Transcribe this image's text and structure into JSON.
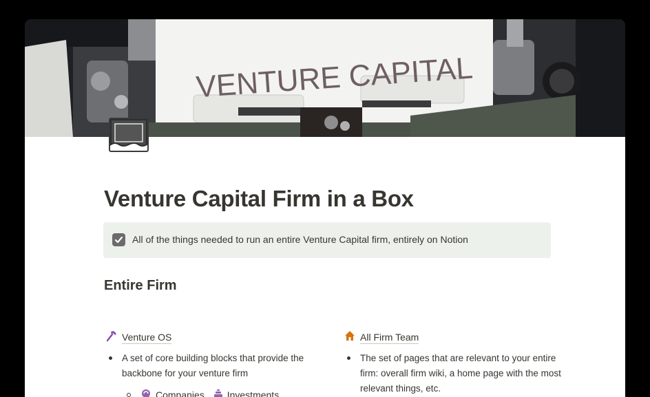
{
  "cover": {
    "banner_text": "VENTURE CAPITAL"
  },
  "page": {
    "title": "Venture Capital Firm in a Box",
    "callout_text": "All of the things needed to run an entire Venture Capital firm, entirely on Notion",
    "section_heading": "Entire Firm"
  },
  "columns": {
    "left": {
      "link_icon": "hammer-icon",
      "link_label": "Venture OS",
      "bullet": "A set of core building blocks that provide the backbone for your venture firm",
      "sub_items": [
        {
          "icon": "companies-icon",
          "label": "Companies"
        },
        {
          "icon": "investments-icon",
          "label": "Investments"
        }
      ],
      "sub_sep": ","
    },
    "right": {
      "link_icon": "house-icon",
      "link_label": "All Firm Team",
      "bullet": "The set of pages that are relevant to your entire firm: overall firm wiki, a home page with the most relevant things, etc."
    }
  },
  "colors": {
    "callout_bg": "#edf1ec",
    "text": "#37352f",
    "hammer_icon": "#8a4cb3",
    "house_icon": "#d9730d",
    "sub_icon": "#9065b0"
  }
}
